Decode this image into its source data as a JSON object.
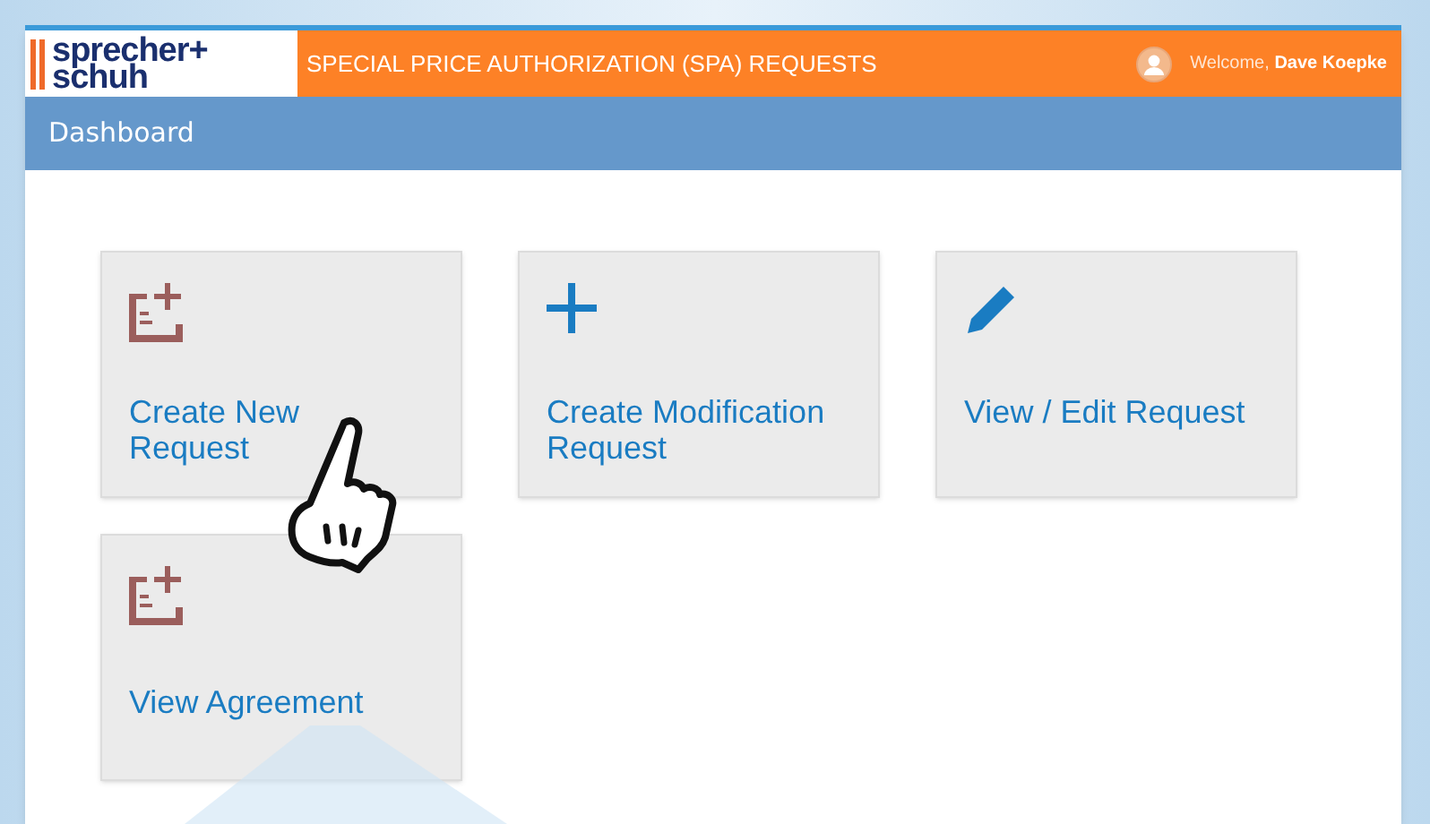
{
  "header": {
    "logo": {
      "line_1": "sprecher+",
      "line_2": "schuh"
    },
    "title": "SPECIAL PRICE AUTHORIZATION (SPA) REQUESTS",
    "welcome": "Welcome,",
    "user": "Dave Koepke"
  },
  "page_title": "Dashboard",
  "tiles": [
    {
      "kind": "doc-plus",
      "label": "Create New Request"
    },
    {
      "kind": "plus",
      "label": "Create Modification Request"
    },
    {
      "kind": "pencil",
      "label": "View / Edit Request"
    },
    {
      "kind": "doc-plus",
      "label": "View Agreement"
    }
  ]
}
